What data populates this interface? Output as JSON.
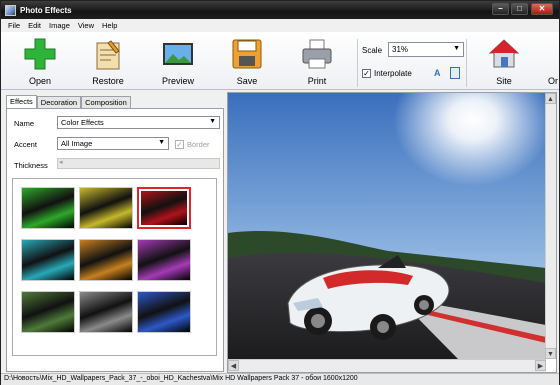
{
  "window": {
    "title": "Photo Effects",
    "min": "–",
    "max": "□",
    "close": "✕"
  },
  "menu": [
    "File",
    "Edit",
    "Image",
    "View",
    "Help"
  ],
  "toolbar": {
    "open": "Open",
    "restore": "Restore",
    "preview": "Preview",
    "save": "Save",
    "print": "Print",
    "scale_label": "Scale",
    "scale_value": "31%",
    "interpolate": "Interpolate",
    "site": "Site",
    "or": "Or"
  },
  "tabs": [
    "Effects",
    "Decoration",
    "Composition"
  ],
  "effects": {
    "name_label": "Name",
    "name_value": "Color Effects",
    "accent_label": "Accent",
    "accent_value": "All Image",
    "border_label": "Border",
    "thickness_label": "Thickness",
    "thumbnails": [
      {
        "name": "green",
        "color": "#2ea82a"
      },
      {
        "name": "yellow",
        "color": "#c6b82a"
      },
      {
        "name": "red",
        "color": "#b0121a",
        "selected": true
      },
      {
        "name": "cyan",
        "color": "#27a9b7"
      },
      {
        "name": "orange",
        "color": "#c6801f"
      },
      {
        "name": "purple",
        "color": "#a43bb6"
      },
      {
        "name": "dark-green",
        "color": "#4f7a3a"
      },
      {
        "name": "gray",
        "color": "#8a8a8a"
      },
      {
        "name": "blue",
        "color": "#2d58c8"
      }
    ]
  },
  "status": {
    "text": "D:\\Новость\\Mix_HD_Wallpapers_Pack_37_-_oboi_HD_Kachestva\\Mix HD Wallpapers Pack 37 - обои  1600x1200"
  }
}
